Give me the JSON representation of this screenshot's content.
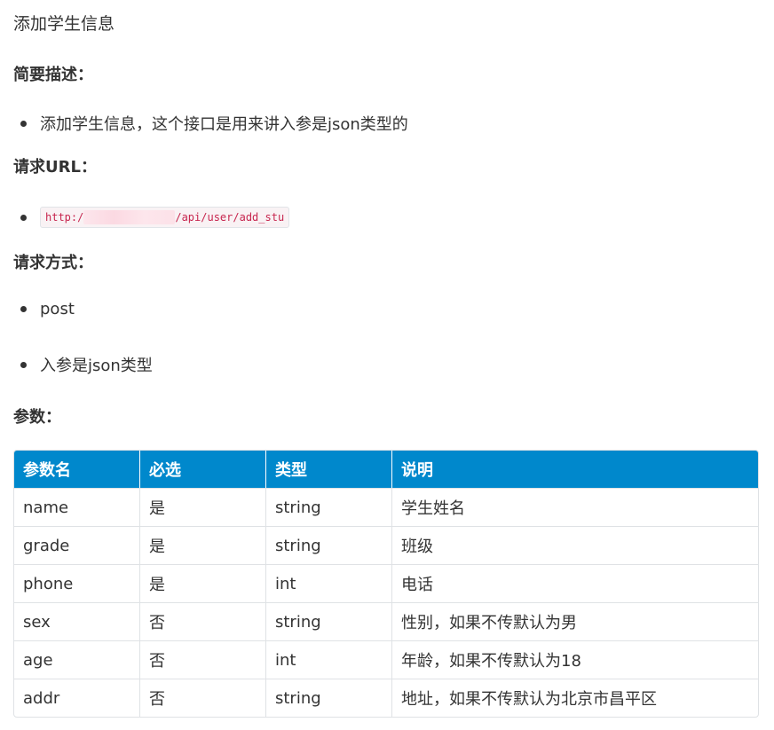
{
  "intro": "添加学生信息",
  "sections": {
    "summary": {
      "title": "简要描述：",
      "item": "添加学生信息，这个接口是用来讲入参是json类型的"
    },
    "url": {
      "title": "请求URL：",
      "prefix": "http:/",
      "suffix": "/api/user/add_stu"
    },
    "method": {
      "title": "请求方式：",
      "items": [
        "post",
        "入参是json类型"
      ]
    },
    "params": {
      "title": "参数："
    }
  },
  "table": {
    "headers": [
      "参数名",
      "必选",
      "类型",
      "说明"
    ],
    "rows": [
      [
        "name",
        "是",
        "string",
        "学生姓名"
      ],
      [
        "grade",
        "是",
        "string",
        "班级"
      ],
      [
        "phone",
        "是",
        "int",
        "电话"
      ],
      [
        "sex",
        "否",
        "string",
        "性别，如果不传默认为男"
      ],
      [
        "age",
        "否",
        "int",
        "年龄，如果不传默认为18"
      ],
      [
        "addr",
        "否",
        "string",
        "地址，如果不传默认为北京市昌平区"
      ]
    ]
  },
  "colors": {
    "header_bg": "#0088cc",
    "code_text": "#c7254e"
  }
}
